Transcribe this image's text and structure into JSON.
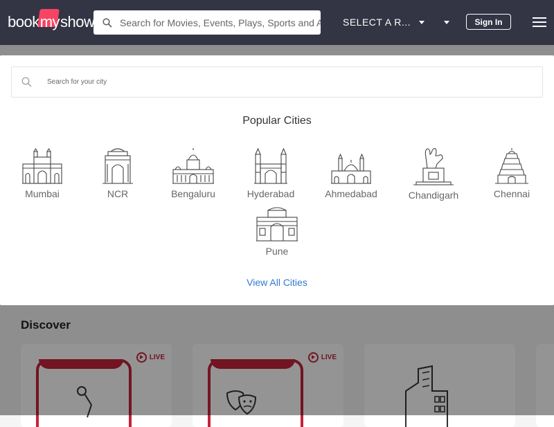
{
  "header": {
    "logo": {
      "left": "book",
      "middle": "my",
      "right": "show"
    },
    "search_placeholder": "Search for Movies, Events, Plays, Sports and Activities",
    "region_label": "SELECT A R...",
    "sign_in_label": "Sign In"
  },
  "modal": {
    "city_search_placeholder": "Search for your city",
    "popular_title": "Popular Cities",
    "cities": [
      {
        "name": "Mumbai",
        "icon": "gateway-of-india-icon"
      },
      {
        "name": "NCR",
        "icon": "india-gate-icon"
      },
      {
        "name": "Bengaluru",
        "icon": "vidhana-soudha-icon"
      },
      {
        "name": "Hyderabad",
        "icon": "charminar-icon"
      },
      {
        "name": "Ahmedabad",
        "icon": "mosque-icon"
      },
      {
        "name": "Chandigarh",
        "icon": "open-hand-monument-icon"
      },
      {
        "name": "Chennai",
        "icon": "temple-gopuram-icon"
      },
      {
        "name": "Pune",
        "icon": "shaniwar-wada-icon"
      }
    ],
    "view_all_label": "View All Cities"
  },
  "background": {
    "section_title": "Discover",
    "cards": [
      {
        "badge": "LIVE",
        "icon": "microphone-icon"
      },
      {
        "badge": "LIVE",
        "icon": "theatre-masks-icon"
      },
      {
        "badge": "",
        "icon": "building-icon"
      }
    ]
  },
  "colors": {
    "header_bg": "#333545",
    "brand": "#f84464",
    "link": "#2f7ad1",
    "live": "#c4233a"
  }
}
